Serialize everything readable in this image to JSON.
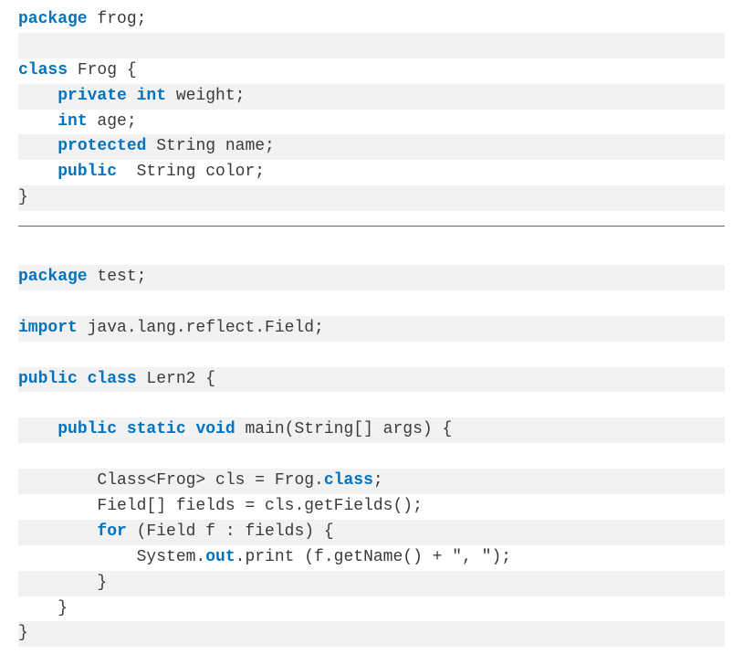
{
  "block1": {
    "lines": [
      {
        "segments": [
          {
            "t": "package",
            "c": "kw"
          },
          {
            "t": " frog;",
            "c": "txt"
          }
        ],
        "stripe": false
      },
      {
        "segments": [],
        "stripe": true
      },
      {
        "segments": [
          {
            "t": "class",
            "c": "kw"
          },
          {
            "t": " Frog {",
            "c": "txt"
          }
        ],
        "stripe": false
      },
      {
        "segments": [
          {
            "t": "    ",
            "c": "txt"
          },
          {
            "t": "private int",
            "c": "kw"
          },
          {
            "t": " weight;",
            "c": "txt"
          }
        ],
        "stripe": true
      },
      {
        "segments": [
          {
            "t": "    ",
            "c": "txt"
          },
          {
            "t": "int",
            "c": "kw"
          },
          {
            "t": " age;",
            "c": "txt"
          }
        ],
        "stripe": false
      },
      {
        "segments": [
          {
            "t": "    ",
            "c": "txt"
          },
          {
            "t": "protected",
            "c": "kw"
          },
          {
            "t": " String name;",
            "c": "txt"
          }
        ],
        "stripe": true
      },
      {
        "segments": [
          {
            "t": "    ",
            "c": "txt"
          },
          {
            "t": "public",
            "c": "kw"
          },
          {
            "t": "  String color;",
            "c": "txt"
          }
        ],
        "stripe": false
      },
      {
        "segments": [
          {
            "t": "}",
            "c": "txt"
          }
        ],
        "stripe": true
      }
    ]
  },
  "block2": {
    "lines": [
      {
        "segments": [],
        "stripe": false
      },
      {
        "segments": [
          {
            "t": "package",
            "c": "kw"
          },
          {
            "t": " test;",
            "c": "txt"
          }
        ],
        "stripe": true
      },
      {
        "segments": [],
        "stripe": false
      },
      {
        "segments": [
          {
            "t": "import",
            "c": "kw"
          },
          {
            "t": " java.lang.reflect.Field;",
            "c": "txt"
          }
        ],
        "stripe": true
      },
      {
        "segments": [],
        "stripe": false
      },
      {
        "segments": [
          {
            "t": "public class",
            "c": "kw"
          },
          {
            "t": " Lern2 {",
            "c": "txt"
          }
        ],
        "stripe": true
      },
      {
        "segments": [],
        "stripe": false
      },
      {
        "segments": [
          {
            "t": "    ",
            "c": "txt"
          },
          {
            "t": "public static void",
            "c": "kw"
          },
          {
            "t": " main(String[] args) {",
            "c": "txt"
          }
        ],
        "stripe": true
      },
      {
        "segments": [],
        "stripe": false
      },
      {
        "segments": [
          {
            "t": "        Class<Frog> cls = Frog.",
            "c": "txt"
          },
          {
            "t": "class",
            "c": "kw"
          },
          {
            "t": ";",
            "c": "txt"
          }
        ],
        "stripe": true
      },
      {
        "segments": [
          {
            "t": "        Field[] fields = cls.getFields();",
            "c": "txt"
          }
        ],
        "stripe": false
      },
      {
        "segments": [
          {
            "t": "        ",
            "c": "txt"
          },
          {
            "t": "for",
            "c": "kw"
          },
          {
            "t": " (Field f : fields) {",
            "c": "txt"
          }
        ],
        "stripe": true
      },
      {
        "segments": [
          {
            "t": "            System.",
            "c": "txt"
          },
          {
            "t": "out",
            "c": "kw"
          },
          {
            "t": ".print (f.getName() + \", \");",
            "c": "txt"
          }
        ],
        "stripe": false
      },
      {
        "segments": [
          {
            "t": "        }",
            "c": "txt"
          }
        ],
        "stripe": true
      },
      {
        "segments": [
          {
            "t": "    }",
            "c": "txt"
          }
        ],
        "stripe": false
      },
      {
        "segments": [
          {
            "t": "}",
            "c": "txt"
          }
        ],
        "stripe": true
      }
    ]
  }
}
